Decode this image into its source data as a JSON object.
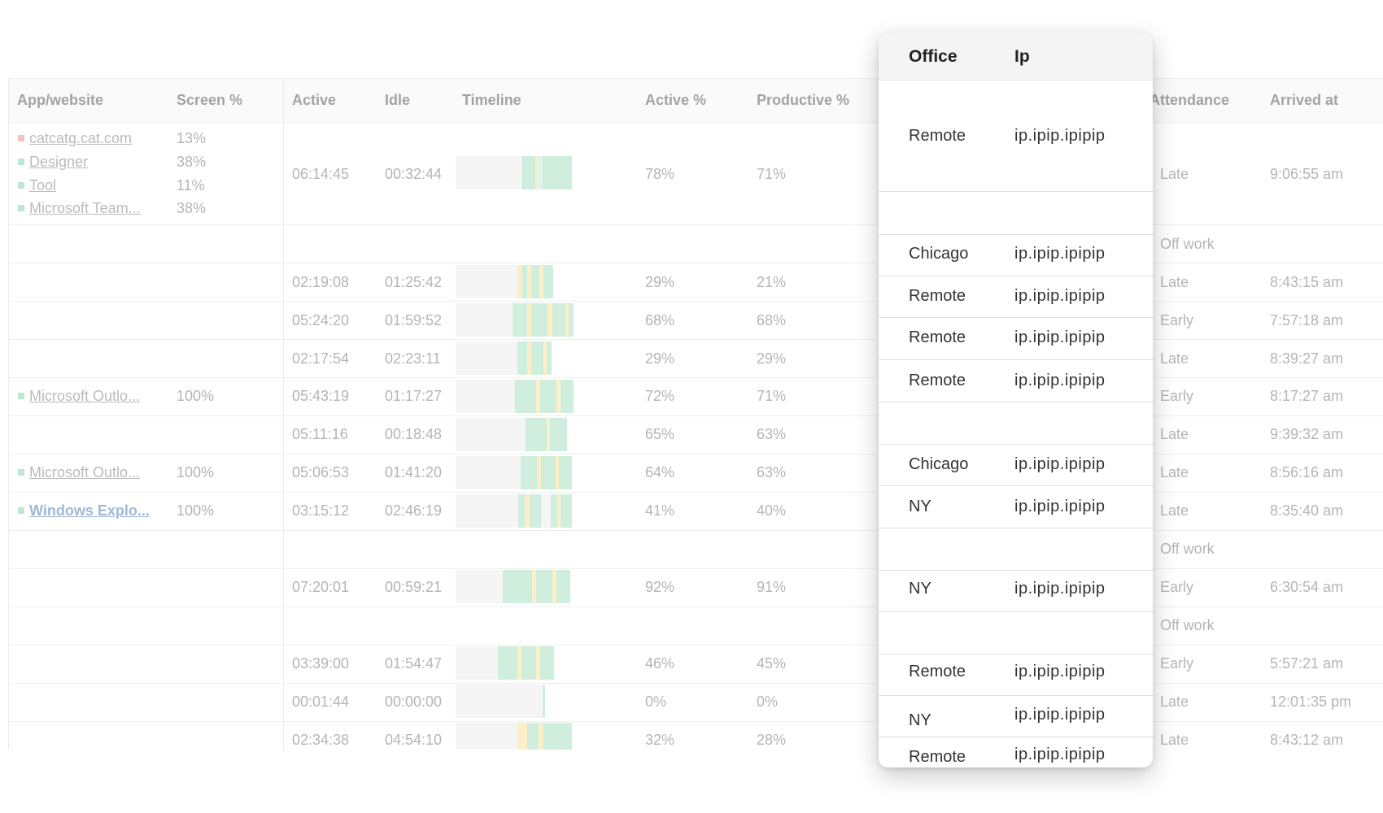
{
  "table": {
    "headers": {
      "app": "App/website",
      "screen": "Screen %",
      "active": "Active",
      "idle": "Idle",
      "timeline": "Timeline",
      "active_pct": "Active %",
      "productive_pct": "Productive %",
      "attendance": "Attendance",
      "arrived": "Arrived at"
    },
    "apps": [
      {
        "name": "catcatg.cat.com",
        "pct": "13%"
      },
      {
        "name": "Designer",
        "pct": "38%"
      },
      {
        "name": "Tool",
        "pct": "11%"
      },
      {
        "name": "Microsoft Team...",
        "pct": "38%"
      },
      {
        "name": "Microsoft Outlo...",
        "pct": "100%"
      },
      {
        "name": "Microsoft Outlo...",
        "pct": "100%"
      },
      {
        "name": "Windows Explo...",
        "pct": "100%"
      }
    ],
    "rows": [
      {
        "active": "06:14:45",
        "idle": "00:32:44",
        "active_pct": "78%",
        "productive_pct": "71%",
        "attendance": "Late",
        "arrived": "9:06:55 am"
      },
      {
        "attendance": "Off work"
      },
      {
        "active": "02:19:08",
        "idle": "01:25:42",
        "active_pct": "29%",
        "productive_pct": "21%",
        "attendance": "Late",
        "arrived": "8:43:15 am"
      },
      {
        "active": "05:24:20",
        "idle": "01:59:52",
        "active_pct": "68%",
        "productive_pct": "68%",
        "attendance": "Early",
        "arrived": "7:57:18 am"
      },
      {
        "active": "02:17:54",
        "idle": "02:23:11",
        "active_pct": "29%",
        "productive_pct": "29%",
        "attendance": "Late",
        "arrived": "8:39:27 am"
      },
      {
        "active": "05:43:19",
        "idle": "01:17:27",
        "active_pct": "72%",
        "productive_pct": "71%",
        "attendance": "Early",
        "arrived": "8:17:27 am"
      },
      {
        "active": "05:11:16",
        "idle": "00:18:48",
        "active_pct": "65%",
        "productive_pct": "63%",
        "attendance": "Late",
        "arrived": "9:39:32 am"
      },
      {
        "active": "05:06:53",
        "idle": "01:41:20",
        "active_pct": "64%",
        "productive_pct": "63%",
        "attendance": "Late",
        "arrived": "8:56:16 am"
      },
      {
        "active": "03:15:12",
        "idle": "02:46:19",
        "active_pct": "41%",
        "productive_pct": "40%",
        "attendance": "Late",
        "arrived": "8:35:40 am"
      },
      {
        "attendance": "Off work"
      },
      {
        "active": "07:20:01",
        "idle": "00:59:21",
        "active_pct": "92%",
        "productive_pct": "91%",
        "attendance": "Early",
        "arrived": "6:30:54 am"
      },
      {
        "attendance": "Off work"
      },
      {
        "active": "03:39:00",
        "idle": "01:54:47",
        "active_pct": "46%",
        "productive_pct": "45%",
        "attendance": "Early",
        "arrived": "5:57:21 am"
      },
      {
        "active": "00:01:44",
        "idle": "00:00:00",
        "active_pct": "0%",
        "productive_pct": "0%",
        "attendance": "Late",
        "arrived": "12:01:35 pm"
      },
      {
        "active": "02:34:38",
        "idle": "04:54:10",
        "active_pct": "32%",
        "productive_pct": "28%",
        "attendance": "Late",
        "arrived": "8:43:12 am"
      }
    ]
  },
  "popup": {
    "headers": {
      "office": "Office",
      "ip": "Ip"
    },
    "rows": [
      {
        "office": "Remote",
        "ip": "ip.ipip.ipipip"
      },
      {
        "office": "",
        "ip": ""
      },
      {
        "office": "Chicago",
        "ip": "ip.ipip.ipipip"
      },
      {
        "office": "Remote",
        "ip": "ip.ipip.ipipip"
      },
      {
        "office": "Remote",
        "ip": "ip.ipip.ipipip"
      },
      {
        "office": "Remote",
        "ip": "ip.ipip.ipipip"
      },
      {
        "office": "",
        "ip": ""
      },
      {
        "office": "Chicago",
        "ip": "ip.ipip.ipipip"
      },
      {
        "office": "NY",
        "ip": "ip.ipip.ipipip"
      },
      {
        "office": "",
        "ip": ""
      },
      {
        "office": "NY",
        "ip": "ip.ipip.ipipip"
      },
      {
        "office": "",
        "ip": ""
      },
      {
        "office": "Remote",
        "ip": "ip.ipip.ipipip"
      },
      {
        "office": "NY",
        "ip": "ip.ipip.ipipip"
      },
      {
        "office": "Remote",
        "ip": "ip.ipip.ipipip"
      }
    ]
  },
  "colors": {
    "productive": "#cfeedd",
    "neutral": "#fbefc8",
    "unproductive_marker": "#f5c2c2",
    "app_marker": "#bfe6d2"
  }
}
